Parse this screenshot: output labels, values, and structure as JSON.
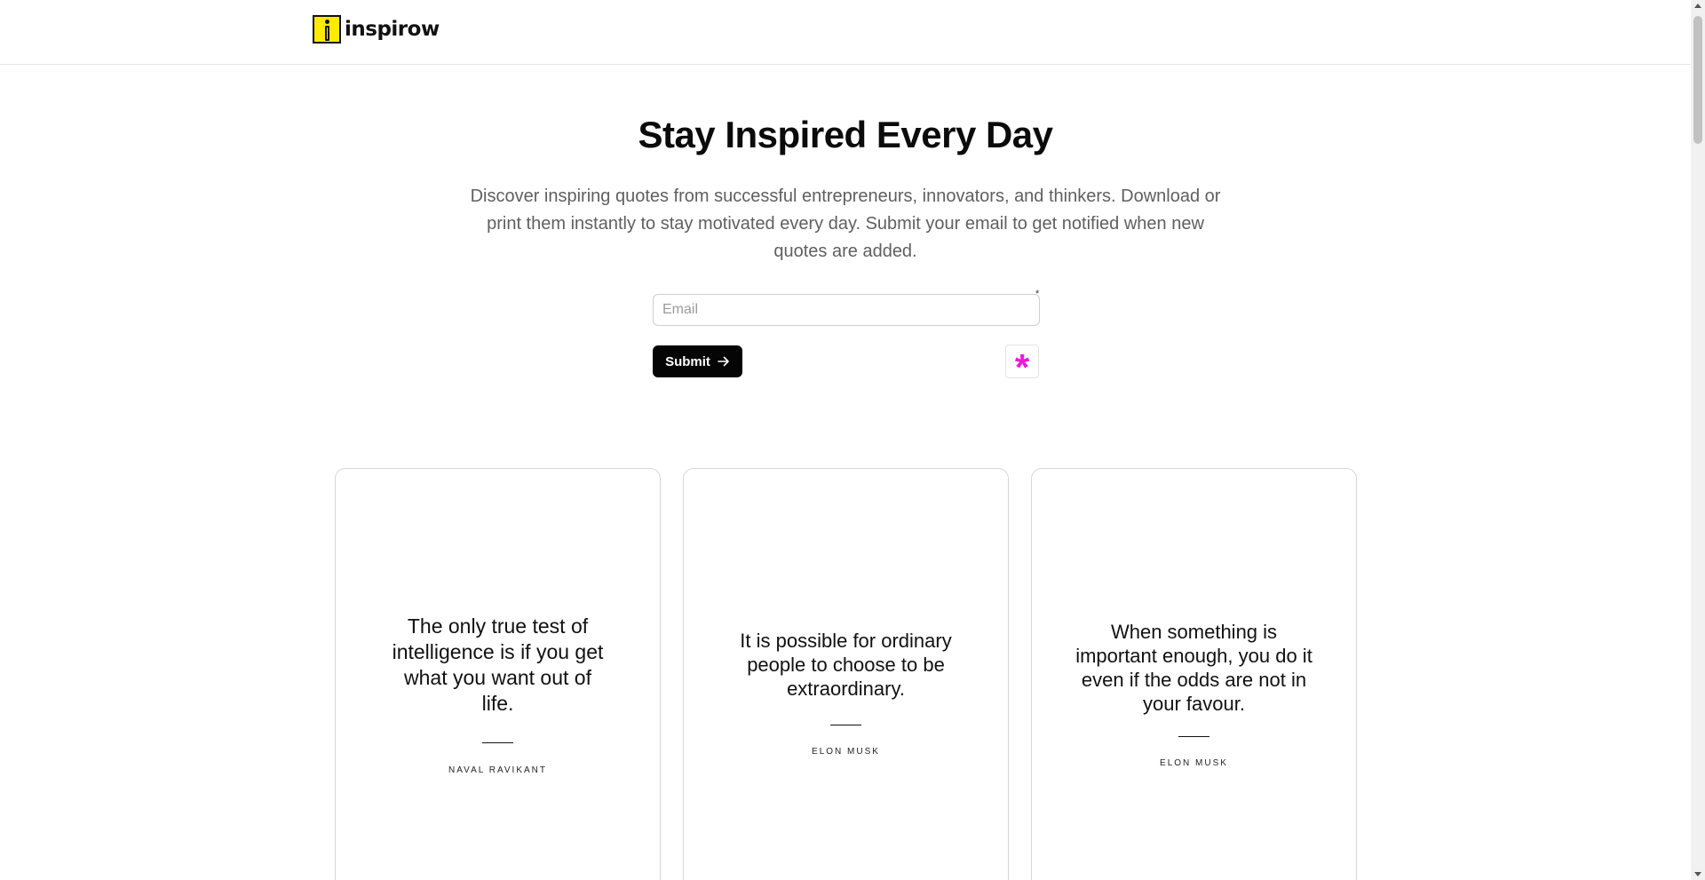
{
  "header": {
    "brand": "inspirow",
    "logo_icon": "info-i-icon",
    "logo_color": "#ffeb00"
  },
  "hero": {
    "title": "Stay Inspired Every Day",
    "subtitle": "Discover inspiring quotes from successful entrepreneurs, innovators, and thinkers. Download or print them instantly to stay motivated every day. Submit your email to get notified when new quotes are added."
  },
  "form": {
    "email_placeholder": "Email",
    "email_value": "",
    "required_marker": "*",
    "submit_label": "Submit",
    "submit_icon": "arrow-right-icon",
    "badge_glyph": "*",
    "badge_color": "#ee1ad6"
  },
  "quotes": [
    {
      "text": "The only true test of intelligence is if you get what you want out of life.",
      "author": "NAVAL RAVIKANT"
    },
    {
      "text": "It is possible for ordinary people to choose to be extraordinary.",
      "author": "ELON MUSK"
    },
    {
      "text": "When something is important enough, you do it even if the odds are not in your favour.",
      "author": "ELON MUSK"
    }
  ]
}
